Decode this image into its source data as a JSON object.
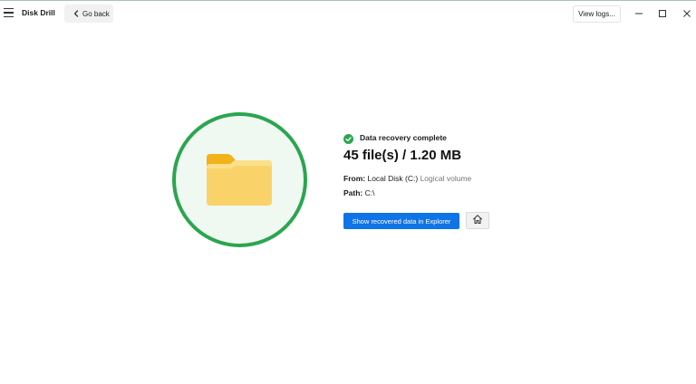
{
  "app": {
    "title": "Disk Drill"
  },
  "toolbar": {
    "back_label": "Go back",
    "view_logs_label": "View logs..."
  },
  "window_controls": [
    "minimize-icon",
    "maximize-icon",
    "close-icon"
  ],
  "icons": {
    "menu": "hamburger-menu-icon",
    "back": "chevron-left-icon",
    "hero": "folder-icon",
    "status": "check-circle-icon",
    "home": "home-icon"
  },
  "colors": {
    "accent_green": "#2aa64f",
    "primary_blue": "#0f74e6",
    "folder_yellow": "#f7c948"
  },
  "result": {
    "status": "Data recovery complete",
    "summary": "45 file(s) / 1.20 MB",
    "from_label": "From:",
    "from_value": "Local Disk (C:)",
    "from_detail": "Logical volume",
    "path_label": "Path:",
    "path_value": "C:\\"
  },
  "actions": {
    "show_in_explorer_label": "Show recovered data in Explorer"
  }
}
